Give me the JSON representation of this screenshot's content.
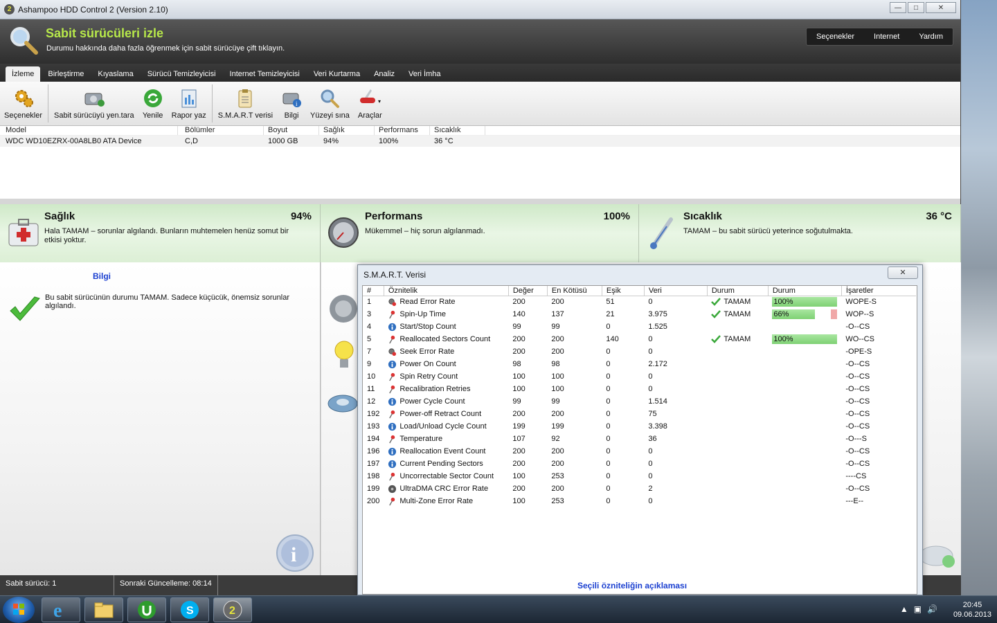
{
  "window": {
    "title": "Ashampoo HDD Control 2 (Version 2.10)",
    "logo": "2"
  },
  "header": {
    "title": "Sabit sürücüleri izle",
    "subtitle": "Durumu hakkında daha fazla öğrenmek için sabit sürücüye çift tıklayın.",
    "menu": [
      "Seçenekler",
      "Internet",
      "Yardım"
    ]
  },
  "tabs": [
    "İzleme",
    "Birleştirme",
    "Kıyaslama",
    "Sürücü Temizleyicisi",
    "Internet Temizleyicisi",
    "Veri Kurtarma",
    "Analiz",
    "Veri İmha"
  ],
  "toolbar": [
    "Seçenekler",
    "Sabit sürücüyü yen.tara",
    "Yenile",
    "Rapor yaz",
    "S.M.A.R.T verisi",
    "Bilgi",
    "Yüzeyi sına",
    "Araçlar"
  ],
  "drives": {
    "columns": [
      "Model",
      "Bölümler",
      "Boyut",
      "Sağlık",
      "Performans",
      "Sıcaklık"
    ],
    "rows": [
      [
        "WDC WD10EZRX-00A8LB0 ATA Device",
        "C,D",
        "1000 GB",
        "94%",
        "100%",
        "36 °C"
      ]
    ]
  },
  "status": {
    "health": {
      "title": "Sağlık",
      "value": "94%",
      "desc": "Hala TAMAM – sorunlar algılandı. Bunların muhtemelen henüz somut bir etkisi yoktur."
    },
    "performance": {
      "title": "Performans",
      "value": "100%",
      "desc": "Mükemmel – hiç sorun algılanmadı."
    },
    "temperature": {
      "title": "Sıcaklık",
      "value": "36 °C",
      "desc": "TAMAM – bu sabit sürücü yeterince soğutulmakta."
    }
  },
  "info": {
    "title": "Bilgi",
    "text": "Bu sabit sürücünün durumu TAMAM. Sadece küçücük, önemsiz sorunlar algılandı."
  },
  "statusbar": {
    "drive": "Sabit sürücü: 1",
    "next_update": "Sonraki Güncelleme: 08:14"
  },
  "smart": {
    "title": "S.M.A.R.T. Verisi",
    "columns": [
      "#",
      "Öznitelik",
      "Değer",
      "En Kötüsü",
      "Eşik",
      "Veri",
      "Durum",
      "Durum",
      "İşaretler"
    ],
    "rows": [
      {
        "id": "1",
        "name": "Read Error Rate",
        "value": "200",
        "worst": "200",
        "thr": "51",
        "data": "0",
        "status": "TAMAM",
        "pct": "100%",
        "pctv": 100,
        "flags": "WOPE-S",
        "icon": "gear"
      },
      {
        "id": "3",
        "name": "Spin-Up Time",
        "value": "140",
        "worst": "137",
        "thr": "21",
        "data": "3.975",
        "status": "TAMAM",
        "pct": "66%",
        "pctv": 66,
        "flags": "WOP--S",
        "icon": "pin"
      },
      {
        "id": "4",
        "name": "Start/Stop Count",
        "value": "99",
        "worst": "99",
        "thr": "0",
        "data": "1.525",
        "status": "",
        "pct": "",
        "pctv": 0,
        "flags": "-O--CS",
        "icon": "info"
      },
      {
        "id": "5",
        "name": "Reallocated Sectors Count",
        "value": "200",
        "worst": "200",
        "thr": "140",
        "data": "0",
        "status": "TAMAM",
        "pct": "100%",
        "pctv": 100,
        "flags": "WO--CS",
        "icon": "pin"
      },
      {
        "id": "7",
        "name": "Seek Error Rate",
        "value": "200",
        "worst": "200",
        "thr": "0",
        "data": "0",
        "status": "",
        "pct": "",
        "pctv": 0,
        "flags": "-OPE-S",
        "icon": "gear"
      },
      {
        "id": "9",
        "name": "Power On Count",
        "value": "98",
        "worst": "98",
        "thr": "0",
        "data": "2.172",
        "status": "",
        "pct": "",
        "pctv": 0,
        "flags": "-O--CS",
        "icon": "info"
      },
      {
        "id": "10",
        "name": "Spin Retry Count",
        "value": "100",
        "worst": "100",
        "thr": "0",
        "data": "0",
        "status": "",
        "pct": "",
        "pctv": 0,
        "flags": "-O--CS",
        "icon": "pin"
      },
      {
        "id": "11",
        "name": "Recalibration Retries",
        "value": "100",
        "worst": "100",
        "thr": "0",
        "data": "0",
        "status": "",
        "pct": "",
        "pctv": 0,
        "flags": "-O--CS",
        "icon": "pin"
      },
      {
        "id": "12",
        "name": "Power Cycle Count",
        "value": "99",
        "worst": "99",
        "thr": "0",
        "data": "1.514",
        "status": "",
        "pct": "",
        "pctv": 0,
        "flags": "-O--CS",
        "icon": "info"
      },
      {
        "id": "192",
        "name": "Power-off Retract Count",
        "value": "200",
        "worst": "200",
        "thr": "0",
        "data": "75",
        "status": "",
        "pct": "",
        "pctv": 0,
        "flags": "-O--CS",
        "icon": "pin"
      },
      {
        "id": "193",
        "name": "Load/Unload Cycle Count",
        "value": "199",
        "worst": "199",
        "thr": "0",
        "data": "3.398",
        "status": "",
        "pct": "",
        "pctv": 0,
        "flags": "-O--CS",
        "icon": "info"
      },
      {
        "id": "194",
        "name": "Temperature",
        "value": "107",
        "worst": "92",
        "thr": "0",
        "data": "36",
        "status": "",
        "pct": "",
        "pctv": 0,
        "flags": "-O---S",
        "icon": "pin"
      },
      {
        "id": "196",
        "name": "Reallocation Event Count",
        "value": "200",
        "worst": "200",
        "thr": "0",
        "data": "0",
        "status": "",
        "pct": "",
        "pctv": 0,
        "flags": "-O--CS",
        "icon": "info"
      },
      {
        "id": "197",
        "name": "Current Pending Sectors",
        "value": "200",
        "worst": "200",
        "thr": "0",
        "data": "0",
        "status": "",
        "pct": "",
        "pctv": 0,
        "flags": "-O--CS",
        "icon": "info"
      },
      {
        "id": "198",
        "name": "Uncorrectable Sector Count",
        "value": "100",
        "worst": "253",
        "thr": "0",
        "data": "0",
        "status": "",
        "pct": "",
        "pctv": 0,
        "flags": "----CS",
        "icon": "pin"
      },
      {
        "id": "199",
        "name": "UltraDMA CRC Error Rate",
        "value": "200",
        "worst": "200",
        "thr": "0",
        "data": "2",
        "status": "",
        "pct": "",
        "pctv": 0,
        "flags": "-O--CS",
        "icon": "disk"
      },
      {
        "id": "200",
        "name": "Multi-Zone Error Rate",
        "value": "100",
        "worst": "253",
        "thr": "0",
        "data": "0",
        "status": "",
        "pct": "",
        "pctv": 0,
        "flags": "---E--",
        "icon": "pin"
      }
    ],
    "desc_title": "Seçili özniteliğin açıklaması"
  },
  "taskbar": {
    "time": "20:45",
    "date": "09.06.2013",
    "apps": [
      "internet-explorer",
      "file-explorer",
      "utorrent",
      "skype",
      "ashampoo-hdd-control"
    ]
  },
  "colors": {
    "header_green": "#b7e84a",
    "link_blue": "#1a3fd0",
    "status_green": "#cfe9c8"
  }
}
